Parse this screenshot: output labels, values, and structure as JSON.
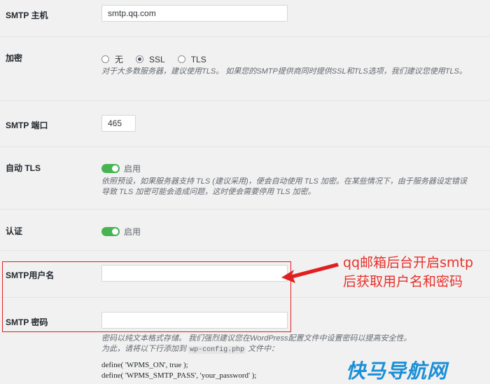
{
  "smtp_host": {
    "label": "SMTP 主机",
    "value": "smtp.qq.com"
  },
  "encryption": {
    "label": "加密",
    "options": [
      "无",
      "SSL",
      "TLS"
    ],
    "selected": "SSL",
    "description": "对于大多数服务器，建议使用TLS。 如果您的SMTP提供商同时提供SSL和TLS选项，我们建议您使用TLS。"
  },
  "smtp_port": {
    "label": "SMTP 端口",
    "value": "465"
  },
  "auto_tls": {
    "label": "自动 TLS",
    "state_label": "启用",
    "description": "依照预设，如果服务器支持 TLS (建议采用)，便会自动使用 TLS 加密。在某些情况下，由于服务器设定错误导致 TLS 加密可能会造成问题，这时便会需要停用 TLS 加密。"
  },
  "auth": {
    "label": "认证",
    "state_label": "启用"
  },
  "smtp_username": {
    "label": "SMTP用户名",
    "value": ""
  },
  "smtp_password": {
    "label": "SMTP 密码",
    "value": "",
    "desc_line1": "密码以纯文本格式存储。 我们强烈建议您在WordPress配置文件中设置密码以提高安全性。",
    "desc_line2_pre": "为此，请将以下行添加到",
    "desc_file": "wp-config.php",
    "desc_line2_post": "文件中：",
    "code_line1": "define( 'WPMS_ON', true );",
    "code_line2": "define( 'WPMS_SMTP_PASS', 'your_password' );"
  },
  "annotation": {
    "line1": "qq邮箱后台开启smtp",
    "line2": "后获取用户名和密码",
    "color": "#e8312a"
  },
  "watermark": "快马导航网",
  "colors": {
    "toggle_on": "#46b450",
    "highlight_box": "#e02020"
  }
}
